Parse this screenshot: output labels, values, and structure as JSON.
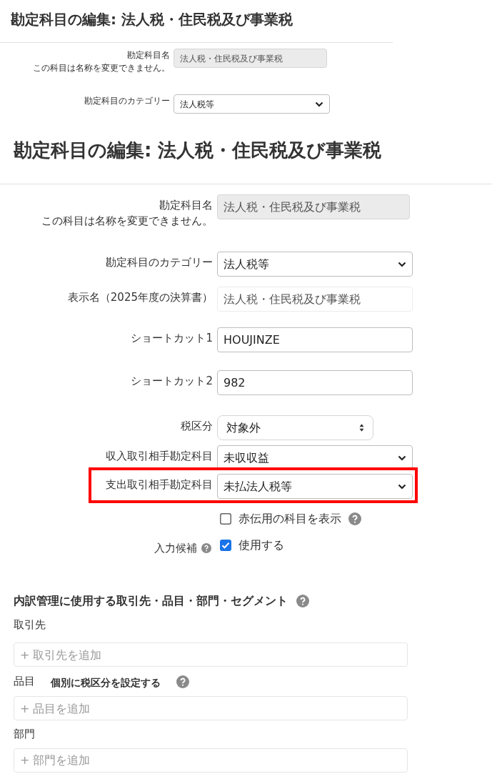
{
  "preview": {
    "title": "勘定科目の編集: 法人税・住民税及び事業税",
    "fields": [
      {
        "kind": "readonly",
        "label": "勘定科目名",
        "note": "この科目は名称を変更できません。",
        "value": "法人税・住民税及び事業税"
      },
      {
        "kind": "select",
        "label": "勘定科目のカテゴリー",
        "value": "法人税等"
      }
    ]
  },
  "title": "勘定科目の編集: 法人税・住民税及び事業税",
  "fields": [
    {
      "kind": "readonly",
      "label": "勘定科目名",
      "note": "この科目は名称を変更できません。",
      "value": "法人税・住民税及び事業税"
    },
    {
      "kind": "select",
      "label": "勘定科目のカテゴリー",
      "value": "法人税等"
    },
    {
      "kind": "text",
      "label": "表示名（2025年度の決算書）",
      "value": "法人税・住民税及び事業税",
      "faint": true
    },
    {
      "kind": "text",
      "label": "ショートカット1",
      "value": "HOUJINZE",
      "faint": false
    },
    {
      "kind": "text",
      "label": "ショートカット2",
      "value": "982",
      "faint": false
    },
    {
      "kind": "spinner",
      "label": "税区分",
      "value": "対象外"
    },
    {
      "kind": "select",
      "label": "収入取引相手勘定科目",
      "value": "未収収益",
      "highlighted": false
    },
    {
      "kind": "select",
      "label": "支出取引相手勘定科目",
      "value": "未払法人税等",
      "highlighted": true
    },
    {
      "kind": "checkbox",
      "option": "赤伝用の科目を表示",
      "checked": false,
      "help": true
    },
    {
      "kind": "checkbox",
      "label": "入力候補",
      "label_help": true,
      "option": "使用する",
      "checked": true,
      "help": false
    }
  ],
  "breakdown": {
    "heading": "内訳管理に使用する取引先・品目・部門・セグメント",
    "groups": [
      {
        "label": "取引先",
        "placeholder": "+ 取引先を追加"
      },
      {
        "label": "品目",
        "option": "個別に税区分を設定する",
        "placeholder": "+ 品目を追加"
      },
      {
        "label": "部門",
        "placeholder": "+ 部門を追加"
      }
    ]
  }
}
